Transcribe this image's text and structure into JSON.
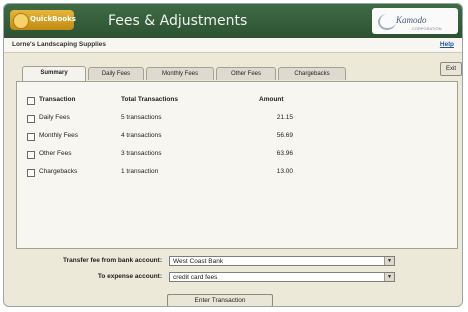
{
  "header": {
    "product_logo_text": "QuickBooks",
    "title": "Fees & Adjustments",
    "brand_name": "Kamodo",
    "brand_tagline": "CORPORATION"
  },
  "company": {
    "name": "Lorne's Landscaping Supplies",
    "help_label": "Help"
  },
  "exit_label": "Exit",
  "tabs": [
    {
      "label": "Summary",
      "active": true
    },
    {
      "label": "Daily Fees",
      "active": false
    },
    {
      "label": "Monthly Fees",
      "active": false
    },
    {
      "label": "Other Fees",
      "active": false
    },
    {
      "label": "Chargebacks",
      "active": false
    }
  ],
  "table": {
    "headers": {
      "transaction": "Transaction",
      "total": "Total Transactions",
      "amount": "Amount"
    },
    "rows": [
      {
        "transaction": "Daily Fees",
        "total": "5 transactions",
        "amount": "21.15"
      },
      {
        "transaction": "Monthly Fees",
        "total": "4 transactions",
        "amount": "56.69"
      },
      {
        "transaction": "Other Fees",
        "total": "3 transactions",
        "amount": "63.96"
      },
      {
        "transaction": "Chargebacks",
        "total": "1 transaction",
        "amount": "13.00"
      }
    ]
  },
  "transfer": {
    "from_label": "Transfer fee from bank account:",
    "from_value": "West Coast Bank",
    "to_label": "To expense account:",
    "to_value": "credit card fees"
  },
  "enter_button": "Enter Transaction"
}
